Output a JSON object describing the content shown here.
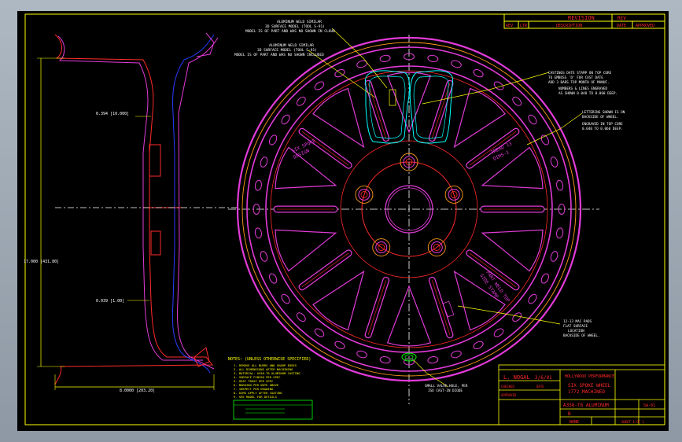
{
  "revision_block": {
    "title": "REVISION",
    "col_rev": "REV",
    "col_zone": "LTR",
    "col_desc": "DESCRIPTION",
    "col_date": "DATE",
    "col_approved": "APPROVED",
    "side": "REV"
  },
  "annotations": {
    "top_left_1": [
      "ALUMINUM WELD SIMILAR",
      "3D SURFACE MODEL (TOOL S-91)",
      "MODEL IS OF PART AND WAS NO SHOWN IN CLOUD"
    ],
    "top_left_2": [
      "ALUMINUM WELD SIMILAR",
      "3D SURFACE MODEL (TOOL S-91)",
      "MODEL IS OF PART AND WAS NO SHOWN INCLUDED"
    ],
    "right_1": [
      "CASTINGS DATE STAMP ON TOP CORE",
      "TO EMBOSS 'D' FOR CAST DATE",
      "ADD 3 BARS TOP MONTH OF MANUF."
    ],
    "right_2": [
      "NUMBERS & LINES ENGRAVED",
      "AS SHOWN 0.040 TO 0.060 DEEP."
    ],
    "right_3": [
      "LETTERING SHOWN IS ON",
      "BACKSIDE OF WHEEL.",
      "ENGRAVED IN TOP CORE",
      "0.040 TO 0.060 DEEP."
    ],
    "right_4": [
      "12-13 MAC PADS",
      "FLAT SURFACE",
      "LOCATION",
      "BACKSIDE OF WHEEL."
    ],
    "valve": [
      "SMALL VALVE HOLE, PER",
      "ISO CAST-IN DIODE"
    ],
    "spoke_text_left": [
      "SIX SPOKE",
      "DESIGN"
    ],
    "spoke_text_right": [
      "TREAD 13",
      "DIMS-1"
    ],
    "spoke_text_bottom": [
      "PART WELD TOP",
      "SIDE STAMP"
    ]
  },
  "dimensions": {
    "d1": "0.394 [10.000]",
    "d2": "17.000 [431.80]",
    "d3": "0.039 [1.00]",
    "d4": "8.0000 [203.20]"
  },
  "notes": {
    "heading": "NOTES: (UNLESS OTHERWISE SPECIFIED)",
    "lines": [
      "1. REMOVE ALL BURRS AND SHARP EDGES",
      "2. ALL DIMENSIONS AFTER MACHINING",
      "3. MATERIAL: A356-T6 ALUMINUM CASTING",
      "4. SURFACE FINISH PER SPEC",
      "5. HEAT TREAT PER SPEC",
      "6. MARKING PER NOTE ABOVE",
      "7. INSPECT PER DRAWING",
      "8. DIMS APPLY AFTER COATING",
      "9. SEE MODEL FOR DETAILS"
    ]
  },
  "title_block": {
    "drawn_by": "L. NOGAL",
    "date": "3/6/01",
    "checked": "CHECKED",
    "date_label": "DATE",
    "approved": "APPROVED",
    "company": "HOLLYWOOD PERFORMANCE",
    "title_1": "SIX SPOKE WHEEL",
    "title_2": "1772 MACHINED",
    "part": "A356-T6 ALUMINUM",
    "size": "B",
    "scale": "NONE",
    "sheet": "SHEET 1 OF 1",
    "dwg_no": "SA-01"
  },
  "colors": {
    "wheel_outer": "#e23bd8",
    "wheel_inner": "#c63cc7",
    "red": "#ff2a2a",
    "yellow": "#ffff00",
    "cyan": "#00ffff",
    "blue": "#2a3cff",
    "green": "#00ff00",
    "white": "#ffffff",
    "orange": "#ff9a1a"
  }
}
